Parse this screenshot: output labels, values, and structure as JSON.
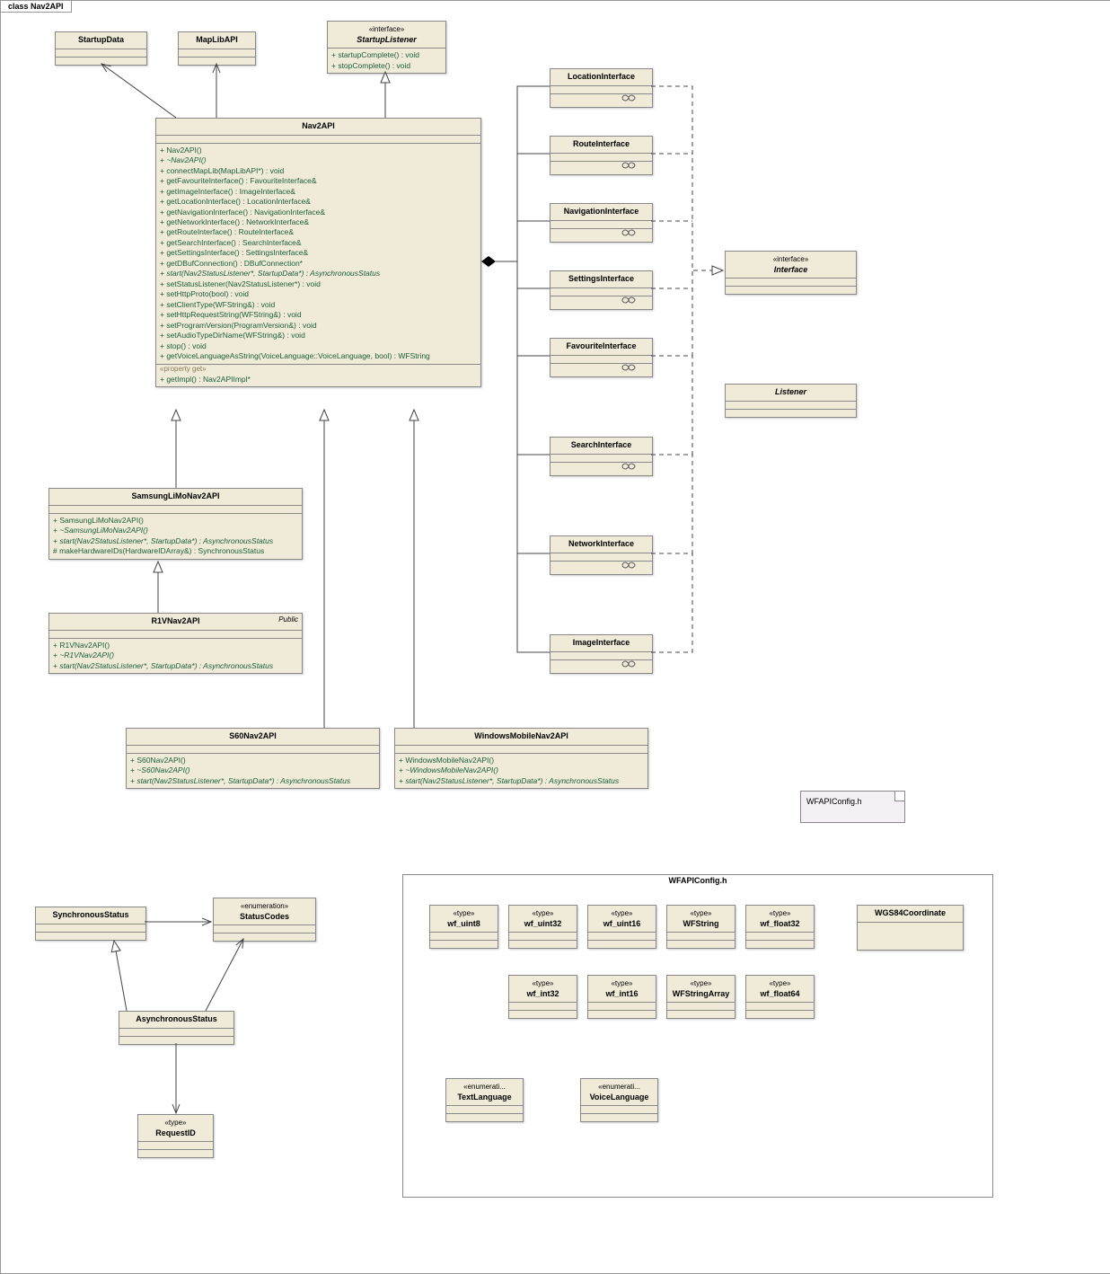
{
  "diagram_title": "class Nav2API",
  "classes": {
    "startupdata": {
      "name": "StartupData"
    },
    "maplibapi": {
      "name": "MapLibAPI"
    },
    "startuplistener": {
      "stereotype": "«interface»",
      "name": "StartupListener",
      "ops": [
        "+  startupComplete() : void",
        "+  stopComplete() : void"
      ]
    },
    "nav2api": {
      "name": "Nav2API",
      "ops": [
        "+  Nav2API()",
        "+  ~Nav2API()",
        "+  connectMapLib(MapLibAPI*) : void",
        "+  getFavouriteInterface() : FavouriteInterface&",
        "+  getImageInterface() : ImageInterface&",
        "+  getLocationInterface() : LocationInterface&",
        "+  getNavigationInterface() : NavigationInterface&",
        "+  getNetworkInterface() : NetworkInterface&",
        "+  getRouteInterface() : RouteInterface&",
        "+  getSearchInterface() : SearchInterface&",
        "+  getSettingsInterface() : SettingsInterface&",
        "+  getDBufConnection() : DBufConnection*",
        "+  start(Nav2StatusListener*, StartupData*) : AsynchronousStatus",
        "+  setStatusListener(Nav2StatusListener*) : void",
        "+  setHttpProto(bool) : void",
        "+  setClientType(WFString&) : void",
        "+  setHttpRequestString(WFString&) : void",
        "+  setProgramVersion(ProgramVersion&) : void",
        "+  setAudioTypeDirName(WFString&) : void",
        "+  stop() : void",
        "+  getVoiceLanguageAsString(VoiceLanguage::VoiceLanguage, bool) : WFString"
      ],
      "propget": "«property get»",
      "ops2": [
        "+  getImpl() : Nav2APIImpl*"
      ]
    },
    "locationinterface": {
      "name": "LocationInterface"
    },
    "routeinterface": {
      "name": "RouteInterface"
    },
    "navigationinterface": {
      "name": "NavigationInterface"
    },
    "settingsinterface": {
      "name": "SettingsInterface"
    },
    "favouriteinterface": {
      "name": "FavouriteInterface"
    },
    "searchinterface": {
      "name": "SearchInterface"
    },
    "networkinterface": {
      "name": "NetworkInterface"
    },
    "imageinterface": {
      "name": "ImageInterface"
    },
    "interface": {
      "stereotype": "«interface»",
      "name": "Interface"
    },
    "listener": {
      "name": "Listener"
    },
    "samsung": {
      "name": "SamsungLiMoNav2API",
      "ops": [
        "+  SamsungLiMoNav2API()",
        "+  ~SamsungLiMoNav2API()",
        "+  start(Nav2StatusListener*, StartupData*) : AsynchronousStatus",
        "#  makeHardwareIDs(HardwareIDArray&) : SynchronousStatus"
      ]
    },
    "r1v": {
      "name": "R1VNav2API",
      "tag": "Public",
      "ops": [
        "+  R1VNav2API()",
        "+  ~R1VNav2API()",
        "+  start(Nav2StatusListener*, StartupData*) : AsynchronousStatus"
      ]
    },
    "s60": {
      "name": "S60Nav2API",
      "ops": [
        "+  S60Nav2API()",
        "+  ~S60Nav2API()",
        "+  start(Nav2StatusListener*, StartupData*) : AsynchronousStatus"
      ]
    },
    "winmobile": {
      "name": "WindowsMobileNav2API",
      "ops": [
        "+  WindowsMobileNav2API()",
        "+  ~WindowsMobileNav2API()",
        "+  start(Nav2StatusListener*, StartupData*) : AsynchronousStatus"
      ]
    },
    "syncstatus": {
      "name": "SynchronousStatus"
    },
    "asyncstatus": {
      "name": "AsynchronousStatus"
    },
    "statuscodes": {
      "stereotype": "«enumeration»",
      "name": "StatusCodes"
    },
    "requestid": {
      "stereotype": "«type»",
      "name": "RequestID"
    }
  },
  "note": {
    "text": "WFAPIConfig.h"
  },
  "frame": {
    "title": "WFAPIConfig.h"
  },
  "types": {
    "wf_uint8": {
      "st": "«type»",
      "nm": "wf_uint8"
    },
    "wf_uint32": {
      "st": "«type»",
      "nm": "wf_uint32"
    },
    "wf_uint16": {
      "st": "«type»",
      "nm": "wf_uint16"
    },
    "wfstring": {
      "st": "«type»",
      "nm": "WFString"
    },
    "wf_float32": {
      "st": "«type»",
      "nm": "wf_float32"
    },
    "wgs84": {
      "nm": "WGS84Coordinate"
    },
    "wf_int32": {
      "st": "«type»",
      "nm": "wf_int32"
    },
    "wf_int16": {
      "st": "«type»",
      "nm": "wf_int16"
    },
    "wfstringarray": {
      "st": "«type»",
      "nm": "WFStringArray"
    },
    "wf_float64": {
      "st": "«type»",
      "nm": "wf_float64"
    },
    "textlang": {
      "st": "«enumerati...",
      "nm": "TextLanguage"
    },
    "voicelang": {
      "st": "«enumerati...",
      "nm": "VoiceLanguage"
    }
  }
}
